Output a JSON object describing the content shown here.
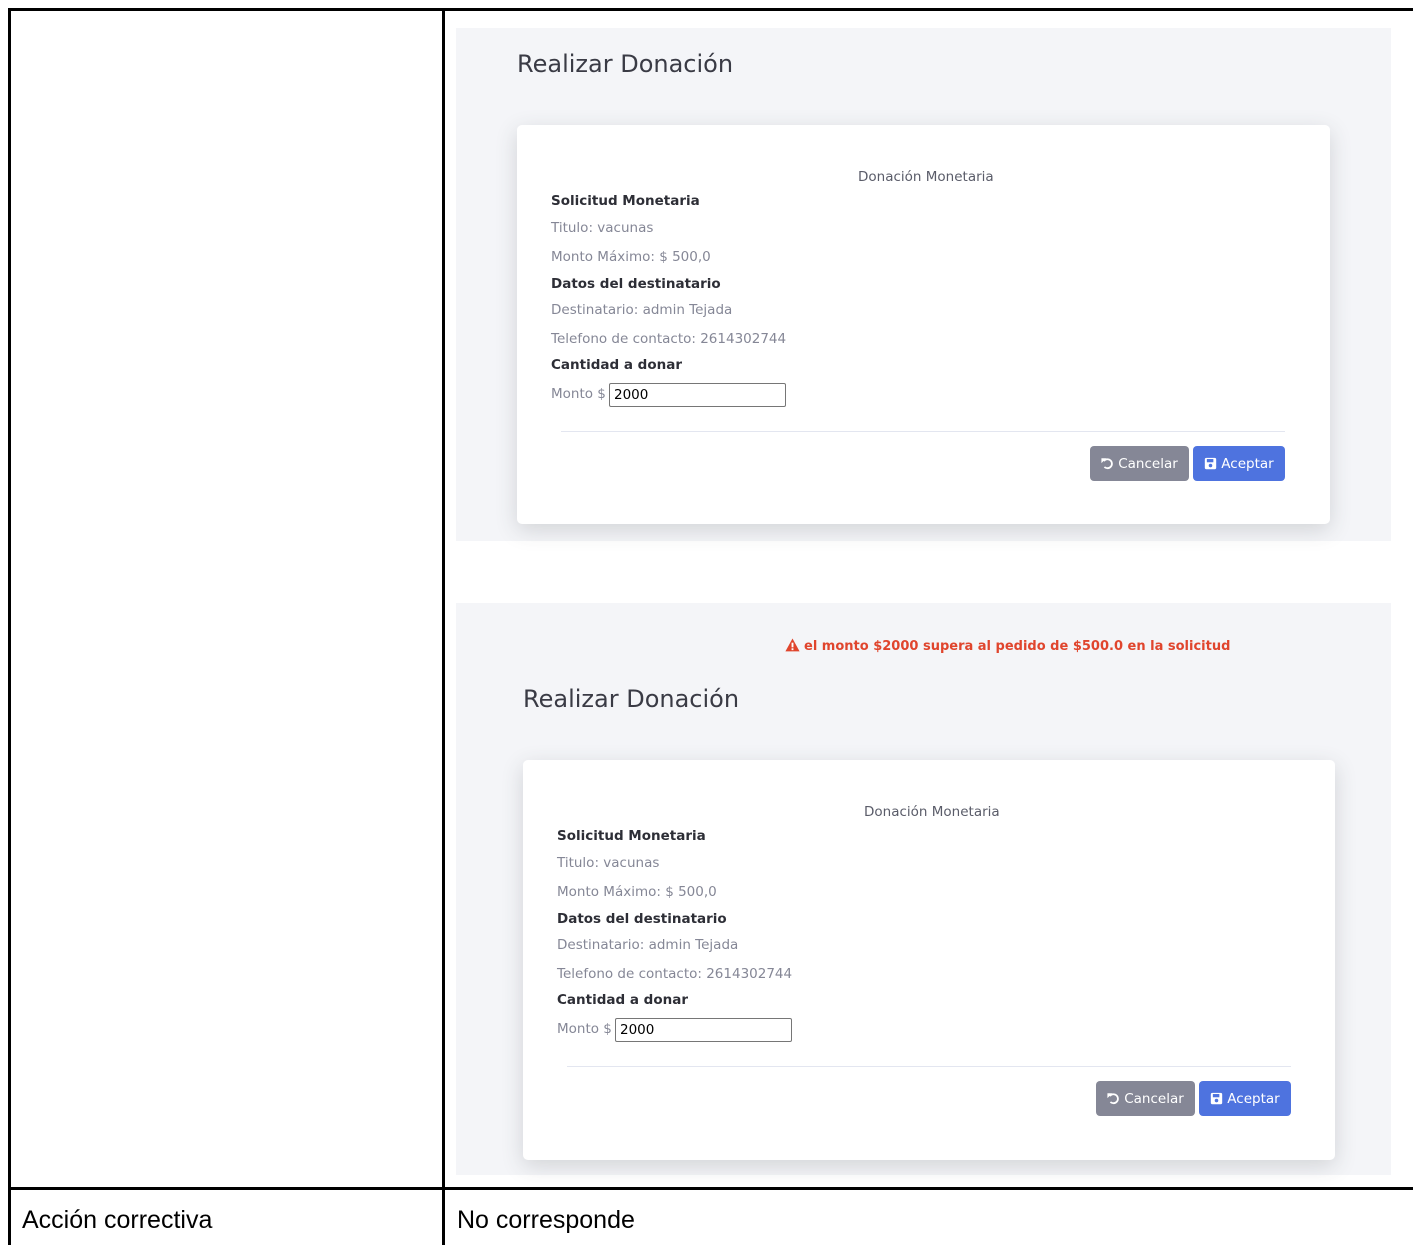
{
  "forms": [
    {
      "page_title": "Realizar Donación",
      "card_header": "Donación Monetaria",
      "section_request": "Solicitud Monetaria",
      "titulo": "Titulo: vacunas",
      "monto_maximo": "Monto Máximo: $ 500,0",
      "section_recipient": "Datos del destinatario",
      "destinatario": "Destinatario: admin Tejada",
      "telefono": "Telefono de contacto: 2614302744",
      "section_amount": "Cantidad a donar",
      "monto_label": "Monto $",
      "monto_value": "2000",
      "cancel_label": "Cancelar",
      "accept_label": "Aceptar"
    },
    {
      "alert": "el monto $2000 supera al pedido de $500.0 en la solicitud",
      "page_title": "Realizar Donación",
      "card_header": "Donación Monetaria",
      "section_request": "Solicitud Monetaria",
      "titulo": "Titulo: vacunas",
      "monto_maximo": "Monto Máximo: $ 500,0",
      "section_recipient": "Datos del destinatario",
      "destinatario": "Destinatario: admin Tejada",
      "telefono": "Telefono de contacto: 2614302744",
      "section_amount": "Cantidad a donar",
      "monto_label": "Monto $",
      "monto_value": "2000",
      "cancel_label": "Cancelar",
      "accept_label": "Aceptar"
    }
  ],
  "table": {
    "row_label": "Acción correctiva",
    "row_value": "No corresponde"
  },
  "colors": {
    "alert": "#e0452d",
    "cancel_button": "#858796",
    "accept_button": "#4e73df",
    "panel_background": "#f4f5f8"
  }
}
